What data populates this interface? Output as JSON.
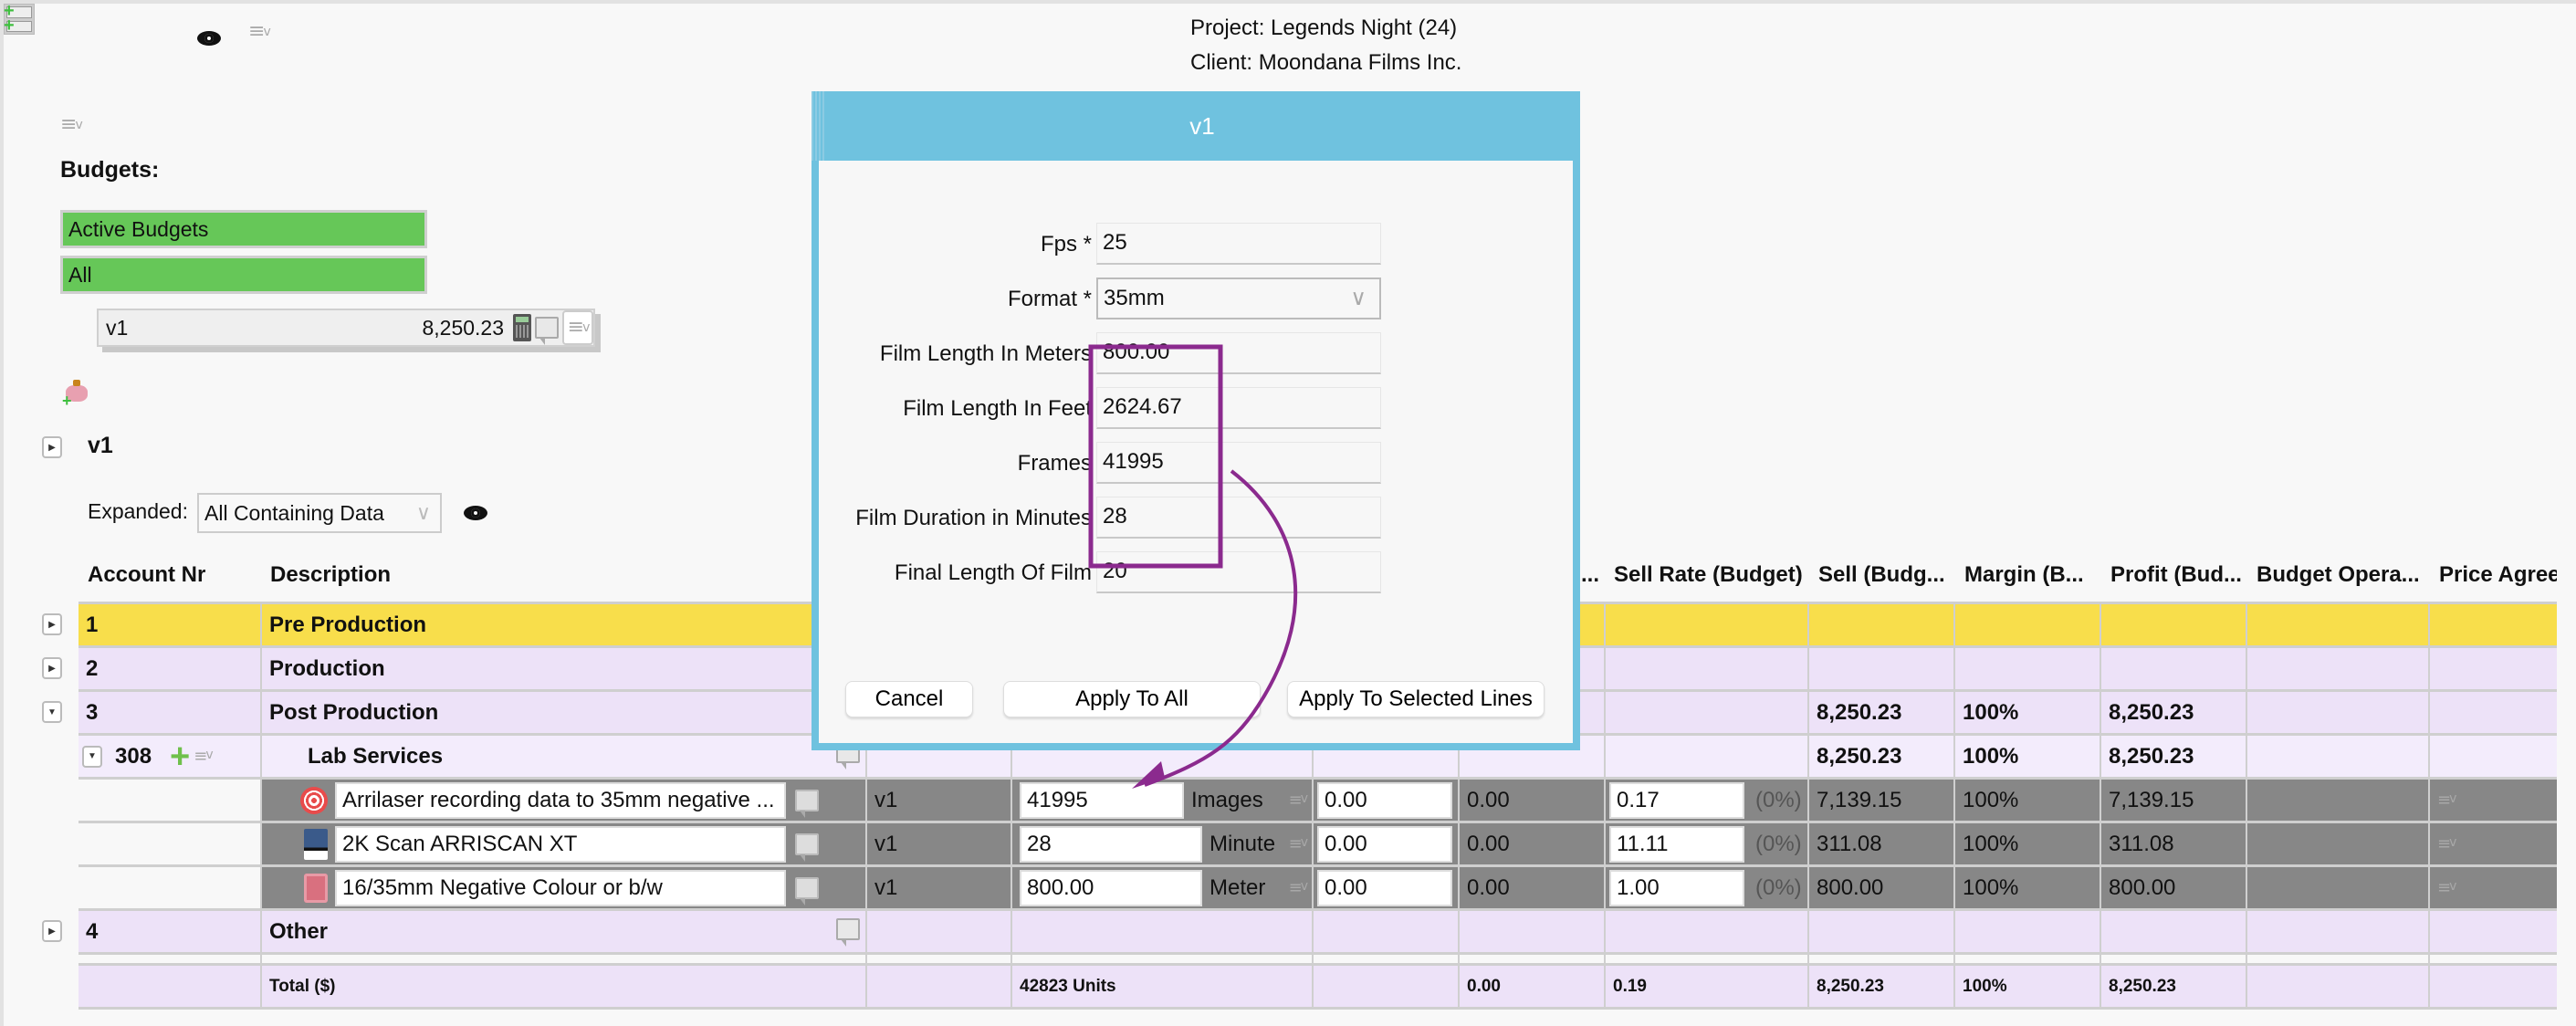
{
  "toolbar": {
    "icons": [
      "add-rows-icon",
      "eye-icon",
      "menu-dropdown-icon"
    ]
  },
  "project": {
    "project_line": "Project: Legends Night (24)",
    "client_line": "Client: Moondana Films Inc."
  },
  "sidebar": {
    "budgets_label": "Budgets:",
    "filters": [
      "Active Budgets",
      "All"
    ],
    "budget_item": {
      "name": "v1",
      "amount": "8,250.23"
    }
  },
  "budget_view": {
    "title": "v1",
    "expanded_label": "Expanded:",
    "expanded_value": "All Containing Data"
  },
  "table": {
    "headers": {
      "account_nr": "Account Nr",
      "description": "Description",
      "hidden_trunc": "...",
      "sell_rate": "Sell Rate (Budget)",
      "sell": "Sell (Budg...",
      "margin": "Margin (B...",
      "profit": "Profit (Bud...",
      "budget_opera": "Budget Opera...",
      "price_agree": "Price Agree"
    },
    "groups": [
      {
        "nr": "1",
        "desc": "Pre Production",
        "sell": "",
        "margin": "",
        "profit": ""
      },
      {
        "nr": "2",
        "desc": "Production",
        "sell": "",
        "margin": "",
        "profit": ""
      },
      {
        "nr": "3",
        "desc": "Post Production",
        "sell": "8,250.23",
        "margin": "100%",
        "profit": "8,250.23"
      },
      {
        "nr": "4",
        "desc": "Other",
        "sell": "",
        "margin": "",
        "profit": ""
      }
    ],
    "sub_account": {
      "nr": "308",
      "desc": "Lab Services",
      "sell": "8,250.23",
      "margin": "100%",
      "profit": "8,250.23"
    },
    "lines": [
      {
        "desc": "Arrilaser recording data to 35mm negative ...",
        "budget": "v1",
        "qty": "41995",
        "unit": "Images",
        "c1": "0.00",
        "c2": "0.00",
        "sell_rate": "0.17",
        "pct": "(0%)",
        "sell": "7,139.15",
        "margin": "100%",
        "profit": "7,139.15"
      },
      {
        "desc": "2K Scan ARRISCAN XT",
        "budget": "v1",
        "qty": "28",
        "unit": "Minute",
        "c1": "0.00",
        "c2": "0.00",
        "sell_rate": "11.11",
        "pct": "(0%)",
        "sell": "311.08",
        "margin": "100%",
        "profit": "311.08"
      },
      {
        "desc": "16/35mm Negative Colour or b/w",
        "budget": "v1",
        "qty": "800.00",
        "unit": "Meter",
        "c1": "0.00",
        "c2": "0.00",
        "sell_rate": "1.00",
        "pct": "(0%)",
        "sell": "800.00",
        "margin": "100%",
        "profit": "800.00"
      }
    ],
    "total": {
      "label": "Total ($)",
      "units": "42823 Units",
      "c2": "0.00",
      "sell_rate": "0.19",
      "sell": "8,250.23",
      "margin": "100%",
      "profit": "8,250.23"
    }
  },
  "modal": {
    "title": "v1",
    "fields": [
      {
        "label": "Fps *",
        "value": "25"
      },
      {
        "label": "Format *",
        "value": "35mm"
      },
      {
        "label": "Film Length In Meters",
        "value": "800.00"
      },
      {
        "label": "Film Length In Feet",
        "value": "2624.67"
      },
      {
        "label": "Frames",
        "value": "41995"
      },
      {
        "label": "Film Duration in Minutes",
        "value": "28"
      },
      {
        "label": "Final Length Of Film",
        "value": "20"
      }
    ],
    "buttons": {
      "cancel": "Cancel",
      "apply_all": "Apply To All",
      "apply_selected": "Apply To Selected Lines"
    }
  },
  "annotation": {
    "color": "#8b2a8e"
  },
  "colors": {
    "modal_header": "#6fc2df",
    "filter_green": "#66c758",
    "row_yellow": "#f8de4b",
    "row_lavender": "#ede2f8",
    "line_grey": "#878787"
  }
}
